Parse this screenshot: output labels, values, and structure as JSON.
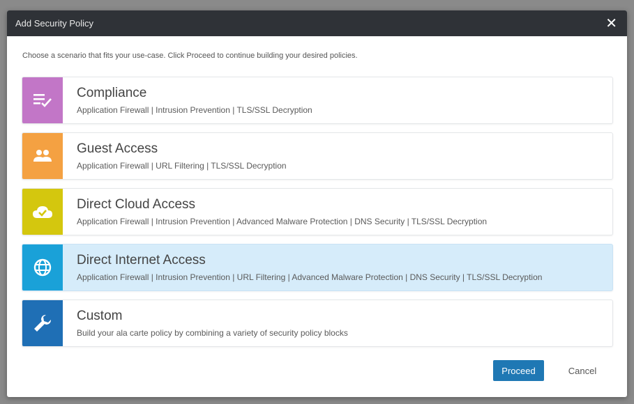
{
  "dialog": {
    "title": "Add Security Policy",
    "close_icon": "close-icon",
    "intro": "Choose a scenario that fits your use-case. Click Proceed to continue building your desired policies."
  },
  "scenarios": [
    {
      "name": "Compliance",
      "description": "Application Firewall | Intrusion Prevention | TLS/SSL Decryption",
      "icon": "checklist-icon",
      "color": "#c276c7"
    },
    {
      "name": "Guest Access",
      "description": "Application Firewall | URL Filtering | TLS/SSL Decryption",
      "icon": "people-icon",
      "color": "#f4a142"
    },
    {
      "name": "Direct Cloud Access",
      "description": "Application Firewall | Intrusion Prevention | Advanced Malware Protection | DNS Security | TLS/SSL Decryption",
      "icon": "cloud-check-icon",
      "color": "#d4c70e"
    },
    {
      "name": "Direct Internet Access",
      "description": "Application Firewall | Intrusion Prevention | URL Filtering | Advanced Malware Protection | DNS Security | TLS/SSL Decryption",
      "icon": "globe-icon",
      "color": "#1aa1d8",
      "selected": true
    },
    {
      "name": "Custom",
      "description": "Build your ala carte policy by combining a variety of security policy blocks",
      "icon": "wrench-icon",
      "color": "#1f6fb5"
    }
  ],
  "footer": {
    "proceed_label": "Proceed",
    "cancel_label": "Cancel"
  }
}
